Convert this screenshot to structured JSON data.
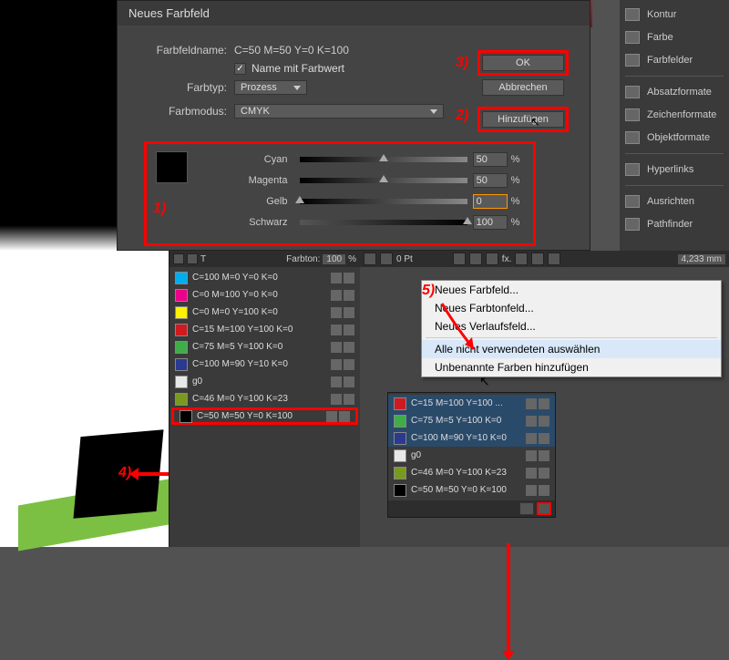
{
  "dialog": {
    "title": "Neues Farbfeld",
    "name_label": "Farbfeldname:",
    "name_value": "C=50 M=50 Y=0 K=100",
    "name_with_value_label": "Name mit Farbwert",
    "type_label": "Farbtyp:",
    "type_value": "Prozess",
    "mode_label": "Farbmodus:",
    "mode_value": "CMYK",
    "cyan_label": "Cyan",
    "magenta_label": "Magenta",
    "yellow_label": "Gelb",
    "black_label": "Schwarz",
    "cyan_val": "50",
    "magenta_val": "50",
    "yellow_val": "0",
    "black_val": "100",
    "pct": "%",
    "ok": "OK",
    "cancel": "Abbrechen",
    "add": "Hinzufügen"
  },
  "annotations": {
    "n1": "1)",
    "n2": "2)",
    "n3": "3)",
    "n4": "4)",
    "n5": "5)"
  },
  "right_panels": {
    "kontur": "Kontur",
    "farbe": "Farbe",
    "farbfelder": "Farbfelder",
    "absatz": "Absatzformate",
    "zeichen": "Zeichenformate",
    "objekt": "Objektformate",
    "hyperlinks": "Hyperlinks",
    "ausrichten": "Ausrichten",
    "pathfinder": "Pathfinder"
  },
  "swatches_mid": {
    "tint_label": "Farbton:",
    "tint_val": "100",
    "tint_pct": "%",
    "T_symbol": "T",
    "items": [
      {
        "name": "C=100 M=0 Y=0 K=0",
        "color": "#00adee"
      },
      {
        "name": "C=0 M=100 Y=0 K=0",
        "color": "#ec008c"
      },
      {
        "name": "C=0 M=0 Y=100 K=0",
        "color": "#fff200"
      },
      {
        "name": "C=15 M=100 Y=100 K=0",
        "color": "#cf1a20"
      },
      {
        "name": "C=75 M=5 Y=100 K=0",
        "color": "#3fae48"
      },
      {
        "name": "C=100 M=90 Y=10 K=0",
        "color": "#2b3990"
      },
      {
        "name": "g0",
        "color": "#e8e8e8"
      },
      {
        "name": "C=46 M=0 Y=100 K=23",
        "color": "#7a9a1f"
      },
      {
        "name": "C=50 M=50 Y=0 K=100",
        "color": "#000000"
      }
    ]
  },
  "rb_toolbar": {
    "pt": "0 Pt",
    "fx": "fx.",
    "val": "4,233 mm"
  },
  "context_menu": {
    "new_swatch": "Neues Farbfeld...",
    "new_tint": "Neues Farbtonfeld...",
    "new_gradient": "Neues Verlaufsfeld...",
    "select_unused": "Alle nicht verwendeten auswählen",
    "add_unnamed": "Unbenannte Farben hinzufügen"
  },
  "swatches_right": {
    "items": [
      {
        "name": "C=15 M=100 Y=100 ...",
        "color": "#cf1a20"
      },
      {
        "name": "C=75 M=5 Y=100 K=0",
        "color": "#3fae48"
      },
      {
        "name": "C=100 M=90 Y=10 K=0",
        "color": "#2b3990"
      },
      {
        "name": "g0",
        "color": "#e8e8e8"
      },
      {
        "name": "C=46 M=0 Y=100 K=23",
        "color": "#7a9a1f"
      },
      {
        "name": "C=50 M=50 Y=0 K=100",
        "color": "#000000"
      }
    ]
  }
}
